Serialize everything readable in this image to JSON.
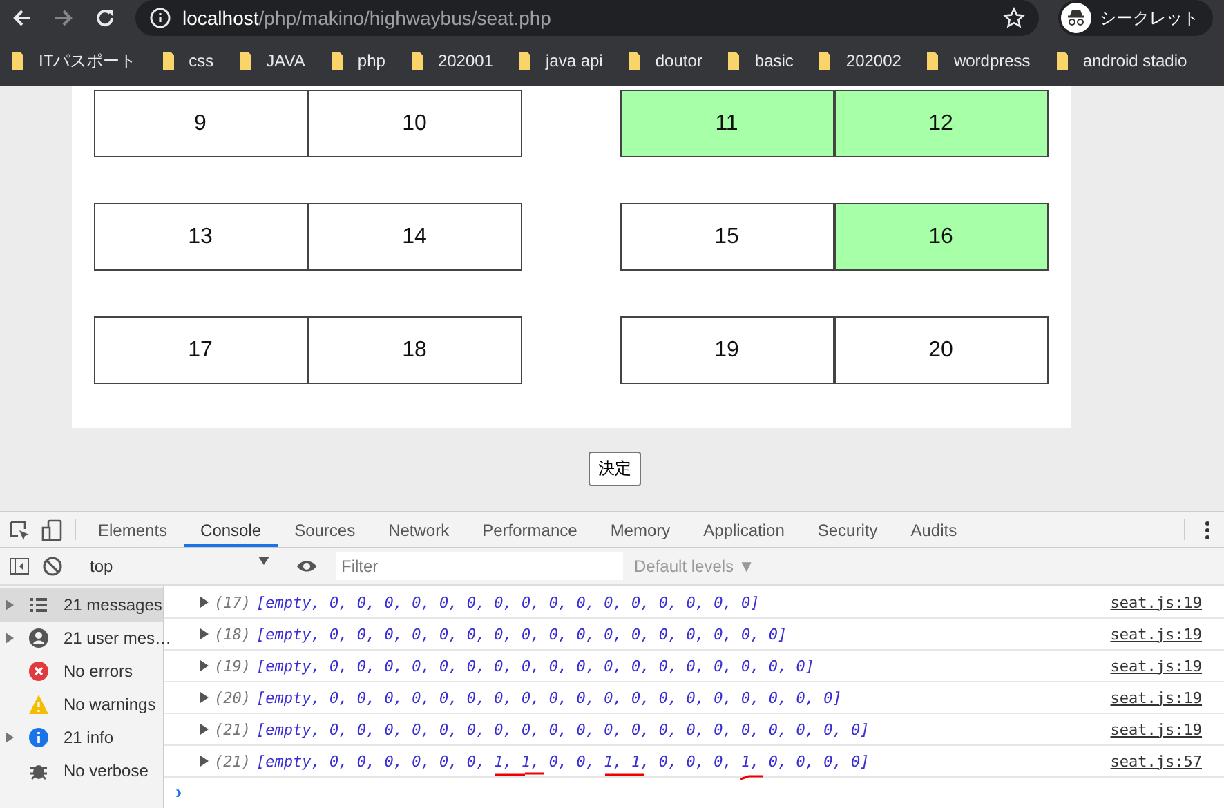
{
  "browser": {
    "url_host": "localhost",
    "url_path": "/php/makino/highwaybus/seat.php",
    "profile": "シークレット",
    "bookmarks": [
      "ITパスポート",
      "css",
      "JAVA",
      "php",
      "202001",
      "java api",
      "doutor",
      "basic",
      "202002",
      "wordpress",
      "android stadio"
    ]
  },
  "seat_rows": [
    {
      "left": [
        {
          "label": "9",
          "selected": false
        },
        {
          "label": "10",
          "selected": false
        }
      ],
      "right": [
        {
          "label": "11",
          "selected": true
        },
        {
          "label": "12",
          "selected": true
        }
      ]
    },
    {
      "left": [
        {
          "label": "13",
          "selected": false
        },
        {
          "label": "14",
          "selected": false
        }
      ],
      "right": [
        {
          "label": "15",
          "selected": false
        },
        {
          "label": "16",
          "selected": true
        }
      ]
    },
    {
      "left": [
        {
          "label": "17",
          "selected": false
        },
        {
          "label": "18",
          "selected": false
        }
      ],
      "right": [
        {
          "label": "19",
          "selected": false
        },
        {
          "label": "20",
          "selected": false
        }
      ]
    }
  ],
  "submit_button": "決定",
  "devtools": {
    "tabs": [
      {
        "label": "Elements",
        "selected": false
      },
      {
        "label": "Console",
        "selected": true
      },
      {
        "label": "Sources",
        "selected": false
      },
      {
        "label": "Network",
        "selected": false
      },
      {
        "label": "Performance",
        "selected": false
      },
      {
        "label": "Memory",
        "selected": false
      },
      {
        "label": "Application",
        "selected": false
      },
      {
        "label": "Security",
        "selected": false
      },
      {
        "label": "Audits",
        "selected": false
      }
    ],
    "context": "top",
    "filter_placeholder": "Filter",
    "levels": "Default levels ▼",
    "sidebar": [
      {
        "kind": "list",
        "label": "21 messages",
        "selected": true,
        "expandable": true
      },
      {
        "kind": "user",
        "label": "21 user mes…",
        "selected": false,
        "expandable": true
      },
      {
        "kind": "error",
        "label": "No errors",
        "selected": false,
        "expandable": false
      },
      {
        "kind": "warning",
        "label": "No warnings",
        "selected": false,
        "expandable": false
      },
      {
        "kind": "info",
        "label": "21 info",
        "selected": false,
        "expandable": true
      },
      {
        "kind": "verbose",
        "label": "No verbose",
        "selected": false,
        "expandable": false
      }
    ],
    "logs": [
      {
        "count": "(17)",
        "message": "[empty, 0, 0, 0, 0, 0, 0, 0, 0, 0, 0, 0, 0, 0, 0, 0, 0]",
        "source": "seat.js:19",
        "annotated": false
      },
      {
        "count": "(18)",
        "message": "[empty, 0, 0, 0, 0, 0, 0, 0, 0, 0, 0, 0, 0, 0, 0, 0, 0, 0]",
        "source": "seat.js:19",
        "annotated": false
      },
      {
        "count": "(19)",
        "message": "[empty, 0, 0, 0, 0, 0, 0, 0, 0, 0, 0, 0, 0, 0, 0, 0, 0, 0, 0]",
        "source": "seat.js:19",
        "annotated": false
      },
      {
        "count": "(20)",
        "message": "[empty, 0, 0, 0, 0, 0, 0, 0, 0, 0, 0, 0, 0, 0, 0, 0, 0, 0, 0, 0]",
        "source": "seat.js:19",
        "annotated": false
      },
      {
        "count": "(21)",
        "message": "[empty, 0, 0, 0, 0, 0, 0, 0, 0, 0, 0, 0, 0, 0, 0, 0, 0, 0, 0, 0, 0]",
        "source": "seat.js:19",
        "annotated": false
      },
      {
        "count": "(21)",
        "message": "[empty, 0, 0, 0, 0, 0, 0, 1, 1, 0, 0, 1, 1, 0, 0, 0, 1, 0, 0, 0, 0]",
        "source": "seat.js:57",
        "annotated": true
      }
    ],
    "prompt": "›"
  }
}
